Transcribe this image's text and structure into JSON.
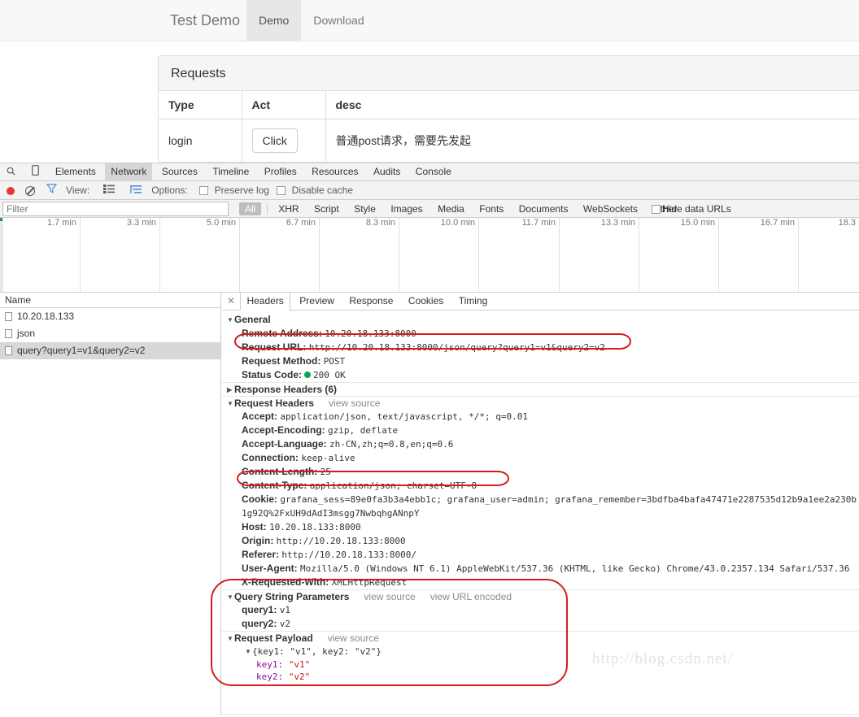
{
  "page": {
    "brand": "Test Demo",
    "nav_items": [
      {
        "label": "Demo",
        "active": true
      },
      {
        "label": "Download",
        "active": false
      }
    ],
    "panel": {
      "heading": "Requests",
      "columns": [
        "Type",
        "Act",
        "desc"
      ],
      "rows": [
        {
          "type": "login",
          "act": "Click",
          "desc": "普通post请求，需要先发起"
        }
      ]
    }
  },
  "devtools": {
    "tabs": [
      {
        "label": "Elements",
        "selected": false
      },
      {
        "label": "Network",
        "selected": true
      },
      {
        "label": "Sources",
        "selected": false
      },
      {
        "label": "Timeline",
        "selected": false
      },
      {
        "label": "Profiles",
        "selected": false
      },
      {
        "label": "Resources",
        "selected": false
      },
      {
        "label": "Audits",
        "selected": false
      },
      {
        "label": "Console",
        "selected": false
      }
    ],
    "toolbar": {
      "record_icon": "record-dot-icon",
      "clear_icon": "clear-icon",
      "filter_icon": "funnel-icon",
      "view_label": "View:",
      "view_list_icon": "list-view-icon",
      "view_large_icon": "large-rows-icon",
      "options_label": "Options:",
      "preserve_log": "Preserve log",
      "disable_cache": "Disable cache"
    },
    "filter": {
      "placeholder": "Filter",
      "value": "",
      "types": [
        "All",
        "XHR",
        "Script",
        "Style",
        "Images",
        "Media",
        "Fonts",
        "Documents",
        "WebSockets",
        "Other"
      ],
      "selected_type": "All",
      "hide_data_urls": "Hide data URLs"
    },
    "timeline": {
      "ticks": [
        "1.7 min",
        "3.3 min",
        "5.0 min",
        "6.7 min",
        "8.3 min",
        "10.0 min",
        "11.7 min",
        "13.3 min",
        "15.0 min",
        "16.7 min",
        "18.3"
      ]
    },
    "names": {
      "header": "Name",
      "rows": [
        {
          "label": "10.20.18.133",
          "selected": false
        },
        {
          "label": "json",
          "selected": false
        },
        {
          "label": "query?query1=v1&query2=v2",
          "selected": true
        }
      ]
    },
    "detail": {
      "close_label": "✕",
      "tabs": [
        {
          "label": "Headers",
          "selected": true
        },
        {
          "label": "Preview",
          "selected": false
        },
        {
          "label": "Response",
          "selected": false
        },
        {
          "label": "Cookies",
          "selected": false
        },
        {
          "label": "Timing",
          "selected": false
        }
      ],
      "general": {
        "title": "General",
        "remote_address_key": "Remote Address:",
        "remote_address_value": "10.20.18.133:8000",
        "request_url_key": "Request URL:",
        "request_url_value": "http://10.20.18.133:8000/json/query?query1=v1&query2=v2",
        "request_method_key": "Request Method:",
        "request_method_value": "POST",
        "status_code_key": "Status Code:",
        "status_code_value": "200 OK"
      },
      "response_headers_title": "Response Headers (6)",
      "request_headers_title": "Request Headers",
      "view_source": "view source",
      "view_url_encoded": "view URL encoded",
      "request_headers": [
        {
          "key": "Accept:",
          "value": "application/json, text/javascript, */*; q=0.01"
        },
        {
          "key": "Accept-Encoding:",
          "value": "gzip, deflate"
        },
        {
          "key": "Accept-Language:",
          "value": "zh-CN,zh;q=0.8,en;q=0.6"
        },
        {
          "key": "Connection:",
          "value": "keep-alive"
        },
        {
          "key": "Content-Length:",
          "value": "25"
        },
        {
          "key": "Content-Type:",
          "value": "application/json; charset=UTF-8"
        }
      ],
      "cookie_key": "Cookie:",
      "cookie_value": "grafana_sess=89e0fa3b3a4ebb1c; grafana_user=admin; grafana_remember=3bdfba4bafa47471e2287535d12b9a1ee2a230b1g92Q%2FxUH9dAdI3msgg7NwbqhgANnpY",
      "request_headers_tail": [
        {
          "key": "Host:",
          "value": "10.20.18.133:8000"
        },
        {
          "key": "Origin:",
          "value": "http://10.20.18.133:8000"
        },
        {
          "key": "Referer:",
          "value": "http://10.20.18.133:8000/"
        },
        {
          "key": "User-Agent:",
          "value": "Mozilla/5.0 (Windows NT 6.1) AppleWebKit/537.36 (KHTML, like Gecko) Chrome/43.0.2357.134 Safari/537.36"
        },
        {
          "key": "X-Requested-With:",
          "value": "XMLHttpRequest"
        }
      ],
      "query_string": {
        "title": "Query String Parameters",
        "params": [
          {
            "key": "query1:",
            "value": "v1"
          },
          {
            "key": "query2:",
            "value": "v2"
          }
        ]
      },
      "payload": {
        "title": "Request Payload",
        "summary": "{key1: \"v1\", key2: \"v2\"}",
        "entries": [
          {
            "key": "key1:",
            "value": "\"v1\""
          },
          {
            "key": "key2:",
            "value": "\"v2\""
          }
        ]
      }
    },
    "watermark": "http://blog.csdn.net/",
    "accent_red": "#d81c1c",
    "status_green": "#0f9d58",
    "payload_key_color": "#881391",
    "payload_value_color": "#c41a16"
  }
}
